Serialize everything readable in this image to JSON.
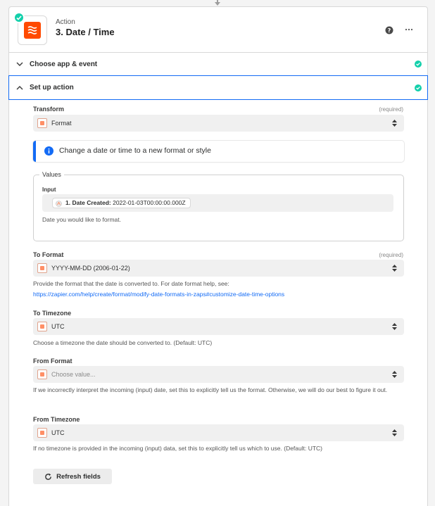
{
  "step": {
    "type": "Action",
    "title": "3. Date / Time"
  },
  "sections": {
    "choose_app": "Choose app & event",
    "setup_action": "Set up action"
  },
  "transform": {
    "label": "Transform",
    "required": "(required)",
    "value": "Format"
  },
  "info": {
    "text": "Change a date or time to a new format or style"
  },
  "values": {
    "legend": "Values",
    "input_label": "Input",
    "pill_label": "1. Date Created:",
    "pill_value": "2022-01-03T00:00:00.000Z",
    "help": "Date you would like to format."
  },
  "to_format": {
    "label": "To Format",
    "required": "(required)",
    "value": "YYYY-MM-DD (2006-01-22)",
    "help": "Provide the format that the date is converted to. For date format help, see:",
    "link": "https://zapier.com/help/create/format/modify-date-formats-in-zaps#customize-date-time-options"
  },
  "to_timezone": {
    "label": "To Timezone",
    "value": "UTC",
    "help": "Choose a timezone the date should be converted to. (Default: UTC)"
  },
  "from_format": {
    "label": "From Format",
    "placeholder": "Choose value...",
    "help": "If we incorrectly interpret the incoming (input) date, set this to explicitly tell us the format. Otherwise, we will do our best to figure it out."
  },
  "from_timezone": {
    "label": "From Timezone",
    "value": "UTC",
    "help": "If no timezone is provided in the incoming (input) data, set this to explicitly tell us which to use. (Default: UTC)"
  },
  "refresh_label": "Refresh fields",
  "colors": {
    "accent": "#136bf5",
    "success": "#13d0ab",
    "brand": "#ff4a00"
  },
  "icons": {
    "app": "date-time-icon",
    "help": "help-icon",
    "more": "more-icon",
    "info": "info-icon",
    "refresh": "refresh-icon"
  }
}
